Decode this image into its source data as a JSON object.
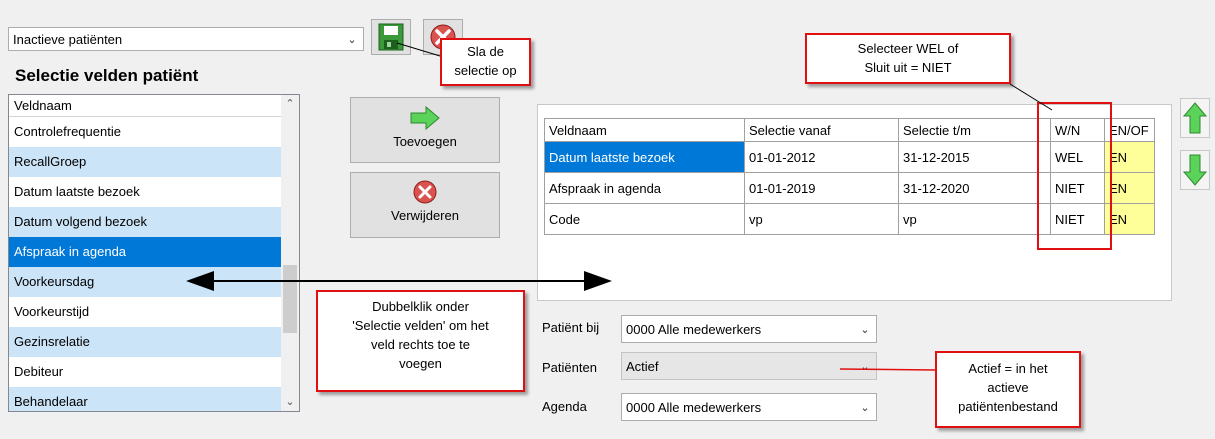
{
  "selection_combo": {
    "value": "Inactieve patiënten"
  },
  "section_title": "Selectie velden patiënt",
  "field_list": {
    "header": "Veldnaam",
    "items": [
      "Controlefrequentie",
      "RecallGroep",
      "Datum laatste bezoek",
      "Datum volgend bezoek",
      "Afspraak in agenda",
      "Voorkeursdag",
      "Voorkeurstijd",
      "Gezinsrelatie",
      "Debiteur",
      "Behandelaar"
    ],
    "selected": "Afspraak in agenda"
  },
  "buttons": {
    "add": "Toevoegen",
    "remove": "Verwijderen"
  },
  "grid": {
    "headers": [
      "Veldnaam",
      "Selectie vanaf",
      "Selectie t/m",
      "W/N",
      "EN/OF"
    ],
    "rows": [
      [
        "Datum laatste bezoek",
        "01-01-2012",
        "31-12-2015",
        "WEL",
        "EN"
      ],
      [
        "Afspraak in agenda",
        "01-01-2019",
        "31-12-2020",
        "NIET",
        "EN"
      ],
      [
        "Code",
        "vp",
        "vp",
        "NIET",
        "EN"
      ]
    ]
  },
  "filters": {
    "patient_bij": {
      "label": "Patiënt bij",
      "value": "0000 Alle medewerkers"
    },
    "patienten": {
      "label": "Patiënten",
      "value": "Actief"
    },
    "agenda": {
      "label": "Agenda",
      "value": "0000 Alle medewerkers"
    }
  },
  "callouts": {
    "save": [
      "Sla de",
      "selectie op"
    ],
    "wn": [
      "Selecteer WEL of",
      "Sluit uit = NIET"
    ],
    "doubleclick": [
      "Dubbelklik onder",
      "'Selectie velden' om het",
      "veld rechts toe te",
      "voegen"
    ],
    "actief": [
      "Actief = in het",
      "actieve",
      "patiëntenbestand"
    ]
  },
  "colors": {
    "selection": "#0078d7",
    "alt_row": "#cce4f7",
    "highlight_yellow": "#ffff99",
    "annotation_red": "#e01010",
    "arrow_green": "#3cb64a"
  }
}
